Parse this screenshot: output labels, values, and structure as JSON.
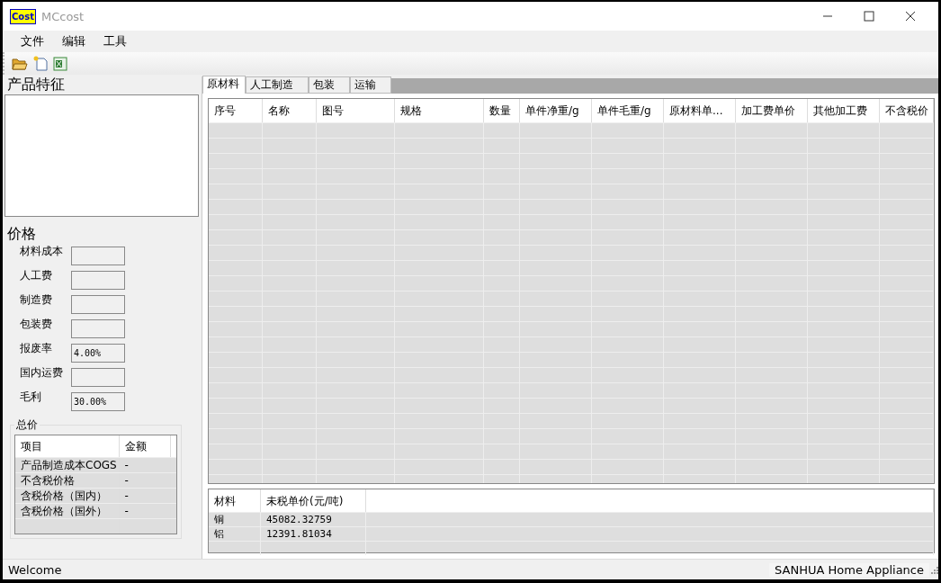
{
  "window": {
    "title": "MCcost",
    "logo": "Cost"
  },
  "menu": [
    "文件",
    "编辑",
    "工具"
  ],
  "product": {
    "title": "产品特征"
  },
  "price": {
    "title": "价格",
    "fields": [
      {
        "label": "材料成本"
      },
      {
        "label": "人工费"
      },
      {
        "label": "制造费"
      },
      {
        "label": "包装费"
      },
      {
        "label": "报废率",
        "value": "4.00%"
      },
      {
        "label": "国内运费"
      },
      {
        "label": "毛利",
        "value": "30.00%"
      }
    ]
  },
  "total": {
    "title": "总价",
    "columns": [
      "项目",
      "金额"
    ],
    "rows": [
      [
        "产品制造成本COGS",
        "-"
      ],
      [
        "不含税价格",
        "-"
      ],
      [
        "含税价格（国内）",
        "-"
      ],
      [
        "含税价格（国外）",
        "-"
      ]
    ]
  },
  "tabs": [
    {
      "label": "原材料",
      "selected": true
    },
    {
      "label": "人工制造",
      "selected": false
    },
    {
      "label": "包装",
      "selected": false
    },
    {
      "label": "运输",
      "selected": false
    }
  ],
  "table": {
    "columns": [
      "序号",
      "名称",
      "图号",
      "规格",
      "数量",
      "单件净重/g",
      "单件毛重/g",
      "原材料单...",
      "加工费单价",
      "其他加工费",
      "不含税价"
    ]
  },
  "materials": {
    "columns": [
      "材料",
      "未税单价(元/吨)"
    ],
    "rows": [
      [
        "铜",
        "45082.32759"
      ],
      [
        "铝",
        "12391.81034"
      ]
    ]
  },
  "status_bar": {
    "left": "Welcome",
    "right": "SANHUA Home Appliance"
  }
}
